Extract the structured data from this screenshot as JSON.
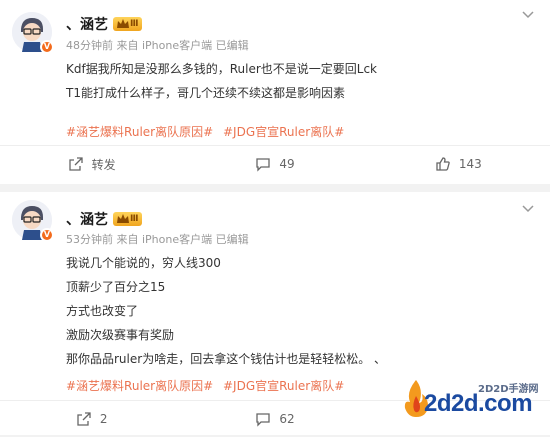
{
  "posts": [
    {
      "username": "、涵艺",
      "vip_level": "Ⅲ",
      "meta": "48分钟前 来自 iPhone客户端 已编辑",
      "lines": [
        "Kdf据我所知是没那么多钱的，Ruler也不是说一定要回Lck",
        "T1能打成什么样子，哥几个还续不续这都是影响因素"
      ],
      "tags": [
        "#涵艺爆料Ruler离队原因#",
        "#JDG官宣Ruler离队#"
      ],
      "actions": {
        "repost": "转发",
        "comments": "49",
        "likes": "143"
      }
    },
    {
      "username": "、涵艺",
      "vip_level": "Ⅲ",
      "meta": "53分钟前 来自 iPhone客户端 已编辑",
      "lines": [
        "我说几个能说的，穷人线300",
        "顶薪少了百分之15",
        "方式也改变了",
        "激励次级赛事有奖励",
        "那你品品ruler为啥走，回去拿这个钱估计也是轻轻松松。 、"
      ],
      "tags": [
        "#涵艺爆料Ruler离队原因#",
        "#JDG官宣Ruler离队#"
      ],
      "actions": {
        "repost": "2",
        "comments": "62",
        "likes": ""
      }
    }
  ],
  "watermark": {
    "site": "2d2d.com",
    "label": "2D2D手游网"
  },
  "colors": {
    "tag": "#eb7350",
    "verified": "#f36b1c",
    "brand_blue": "#1b4aa0"
  }
}
